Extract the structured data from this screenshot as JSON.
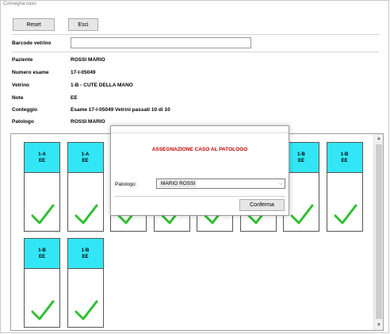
{
  "window": {
    "title": "Consegna caso"
  },
  "toolbar": {
    "reset_label": "Reset",
    "exit_label": "Esci"
  },
  "barcode": {
    "label": "Barcode vetrino",
    "value": ""
  },
  "fields": [
    {
      "label": "Paziente",
      "value": "ROSSI MARIO"
    },
    {
      "label": "Numero esame",
      "value": "17-I-05049"
    },
    {
      "label": "Vetrino",
      "value": "1-B - CUTE DELLA MANO"
    },
    {
      "label": "Note",
      "value": "EE"
    },
    {
      "label": "Conteggio",
      "value": "Esame 17-I-05049 Vetrini passati 10 di 10"
    },
    {
      "label": "Patologo",
      "value": "ROSSI MARIO"
    }
  ],
  "slides": [
    {
      "code": "1-A",
      "stain": "EE",
      "checked": true
    },
    {
      "code": "1-A",
      "stain": "EE",
      "checked": true
    },
    {
      "code": "",
      "stain": "",
      "checked": true
    },
    {
      "code": "",
      "stain": "",
      "checked": true
    },
    {
      "code": "",
      "stain": "",
      "checked": true
    },
    {
      "code": "",
      "stain": "",
      "checked": true
    },
    {
      "code": "1-B",
      "stain": "EE",
      "checked": true
    },
    {
      "code": "1-B",
      "stain": "EE",
      "checked": true
    },
    {
      "code": "1-B",
      "stain": "EE",
      "checked": true
    },
    {
      "code": "1-B",
      "stain": "EE",
      "checked": true
    }
  ],
  "dialog": {
    "title": "ASSEGNAZIONE CASO AL PATOLOGO",
    "pathologist_label": "Patologo:",
    "pathologist_value": "MARIO ROSSI",
    "confirm_label": "Conferma"
  },
  "colors": {
    "slide_header": "#33e6f5",
    "check": "#2fbf2f",
    "dialog_title": "#c00000"
  },
  "icons": {
    "check": "checkmark-icon",
    "dropdown": "chevron-down-icon",
    "scroll_up": "scroll-up-arrow",
    "scroll_down": "scroll-down-arrow"
  }
}
